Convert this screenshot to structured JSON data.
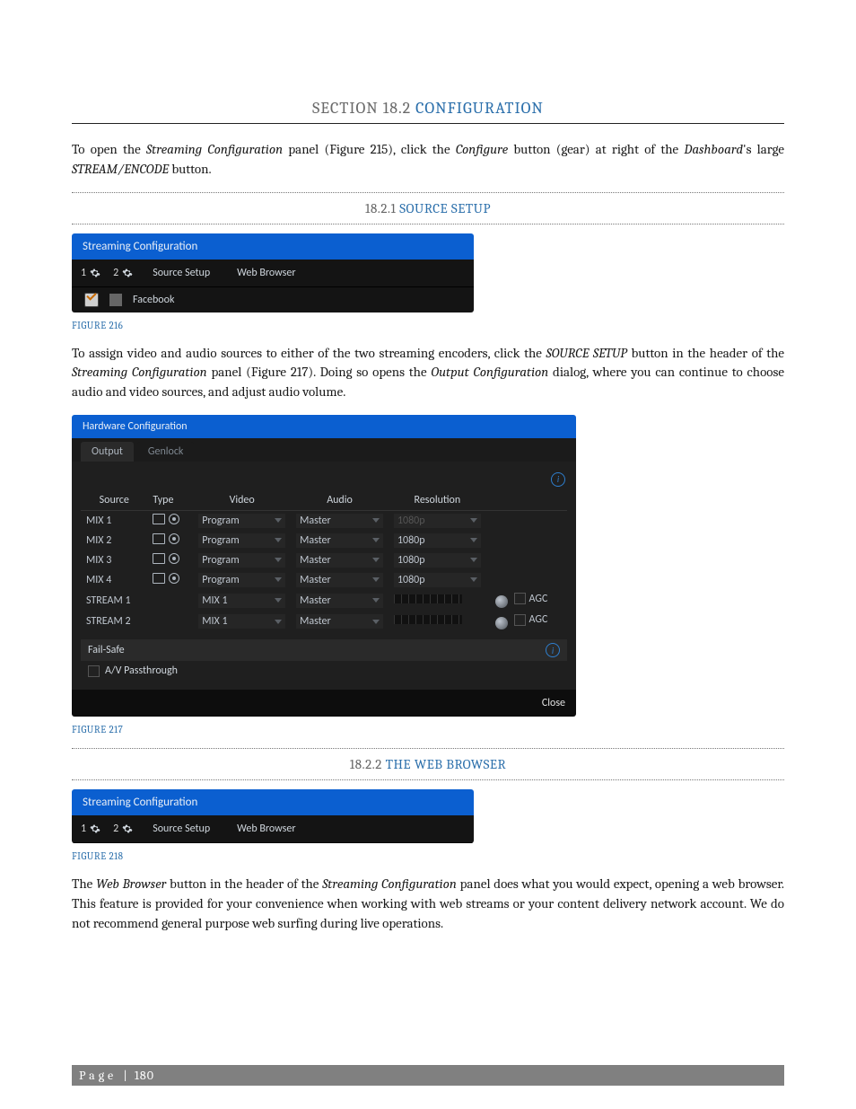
{
  "section": {
    "prefix": "SECTION 18.2 ",
    "title": "CONFIGURATION"
  },
  "intro_html": "To open the <span class='ital'>Streaming Configuration</span> panel (Figure 215), click the <span class='ital'>Configure</span> button (gear) at right of the <span class='ital'>Dashboard</span>'s large <span class='ital'>STREAM/ENCODE</span> button.",
  "sub1": {
    "num": "18.2.1 ",
    "title": "SOURCE SETUP"
  },
  "fig216": {
    "window_title": "Streaming Configuration",
    "slot1": "1",
    "slot2": "2",
    "tab_source": "Source Setup",
    "tab_web": "Web Browser",
    "encoder_name": "Facebook",
    "caption": "FIGURE 216"
  },
  "para2_html": "To assign video and audio sources to either of the two streaming encoders, click the <span class='ital'>SOURCE SETUP</span> button in the header of the <span class='ital'>Streaming Configuration</span> panel (Figure 217).  Doing so opens the <span class='ital'>Output Configuration</span> dialog, where you can continue to choose audio and video sources, and adjust audio volume.",
  "hw": {
    "title": "Hardware Configuration",
    "tab_output": "Output",
    "tab_genlock": "Genlock",
    "cols": {
      "source": "Source",
      "type": "Type",
      "video": "Video",
      "audio": "Audio",
      "res": "Resolution"
    },
    "rows": [
      {
        "source": "MIX 1",
        "video": "Program",
        "audio": "Master",
        "res": "1080p",
        "res_dim": true,
        "type_icons": true
      },
      {
        "source": "MIX 2",
        "video": "Program",
        "audio": "Master",
        "res": "1080p",
        "res_dim": false,
        "type_icons": true
      },
      {
        "source": "MIX 3",
        "video": "Program",
        "audio": "Master",
        "res": "1080p",
        "res_dim": false,
        "type_icons": true
      },
      {
        "source": "MIX 4",
        "video": "Program",
        "audio": "Master",
        "res": "1080p",
        "res_dim": false,
        "type_icons": true
      },
      {
        "source": "STREAM 1",
        "video": "MIX 1",
        "audio": "Master",
        "meter": true,
        "agc": "AGC"
      },
      {
        "source": "STREAM 2",
        "video": "MIX 1",
        "audio": "Master",
        "meter": true,
        "agc": "AGC"
      }
    ],
    "failsafe": "Fail-Safe",
    "passthrough": "A/V Passthrough",
    "close": "Close",
    "caption": "FIGURE 217"
  },
  "sub2": {
    "num": "18.2.2 ",
    "title": "THE WEB BROWSER"
  },
  "fig218": {
    "window_title": "Streaming Configuration",
    "slot1": "1",
    "slot2": "2",
    "tab_source": "Source Setup",
    "tab_web": "Web Browser",
    "caption": "FIGURE 218"
  },
  "para3_html": "The <span class='ital'>Web Browser</span> button in the header of the <span class='ital'>Streaming Configuration</span> panel does what you would expect, opening a web browser. This feature is provided for your convenience when working with web streams or your content delivery network account. We do not recommend general purpose web surfing during live operations.",
  "footer": {
    "label": "Page",
    "sep": "|",
    "num": "180"
  }
}
